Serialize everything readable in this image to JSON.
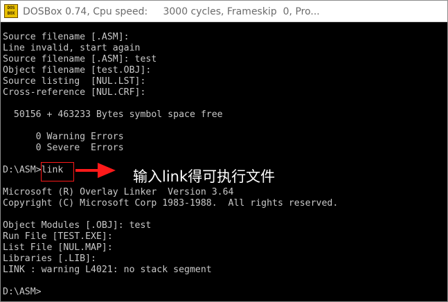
{
  "window": {
    "title": "DOSBox 0.74, Cpu speed:     3000 cycles, Frameskip  0, Pro...",
    "icon_text_top": "DOS",
    "icon_text_bottom": "BOX",
    "icon": "dosbox-app-icon"
  },
  "terminal": {
    "lines": [
      "Source filename [.ASM]:",
      "Line invalid, start again",
      "Source filename [.ASM]: test",
      "Object filename [test.OBJ]:",
      "Source listing  [NUL.LST]:",
      "Cross-reference [NUL.CRF]:",
      "",
      "  50156 + 463233 Bytes symbol space free",
      "",
      "      0 Warning Errors",
      "      0 Severe  Errors",
      "",
      "D:\\ASM>link",
      "",
      "Microsoft (R) Overlay Linker  Version 3.64",
      "Copyright (C) Microsoft Corp 1983-1988.  All rights reserved.",
      "",
      "Object Modules [.OBJ]: test",
      "Run File [TEST.EXE]:",
      "List File [NUL.MAP]:",
      "Libraries [.LIB]:",
      "LINK : warning L4021: no stack segment",
      "",
      "D:\\ASM>"
    ]
  },
  "annotation": {
    "text": "输入link得可执行文件",
    "arrow_color": "#ff1a1a",
    "box_color": "#ff1a1a"
  },
  "colors": {
    "terminal_bg": "#000000",
    "terminal_fg": "#c8c8c8",
    "titlebar_bg": "#ffffff",
    "titlebar_fg": "#6b6b6b"
  }
}
